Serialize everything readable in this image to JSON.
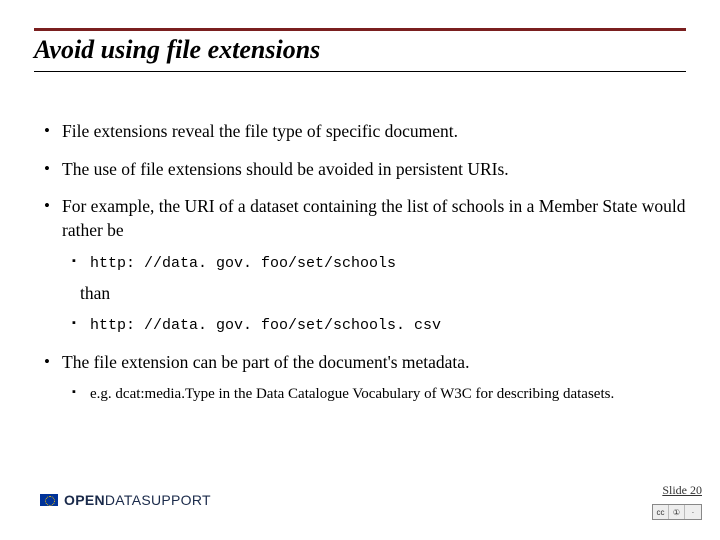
{
  "title": "Avoid using file extensions",
  "bullets": {
    "b1": "File extensions reveal the file type of specific document.",
    "b2": "The use of file extensions should be avoided in persistent URIs.",
    "b3": "For example, the URI of a dataset  containing the list of schools in a Member State would rather be",
    "b3_uri_good": "http: //data. gov. foo/set/schools",
    "b3_than": "than",
    "b3_uri_bad": "http: //data. gov. foo/set/schools. csv",
    "b4": "The file extension can be part of the document's metadata.",
    "b4_sub": "e.g. dcat:media.Type in the Data Catalogue Vocabulary of W3C for describing datasets."
  },
  "footer": {
    "logo_open": "OPEN",
    "logo_data": "DATA",
    "logo_support": "SUPPORT",
    "slide_label": "Slide 20",
    "cc1": "cc",
    "cc2": "①",
    "cc3": "·"
  }
}
